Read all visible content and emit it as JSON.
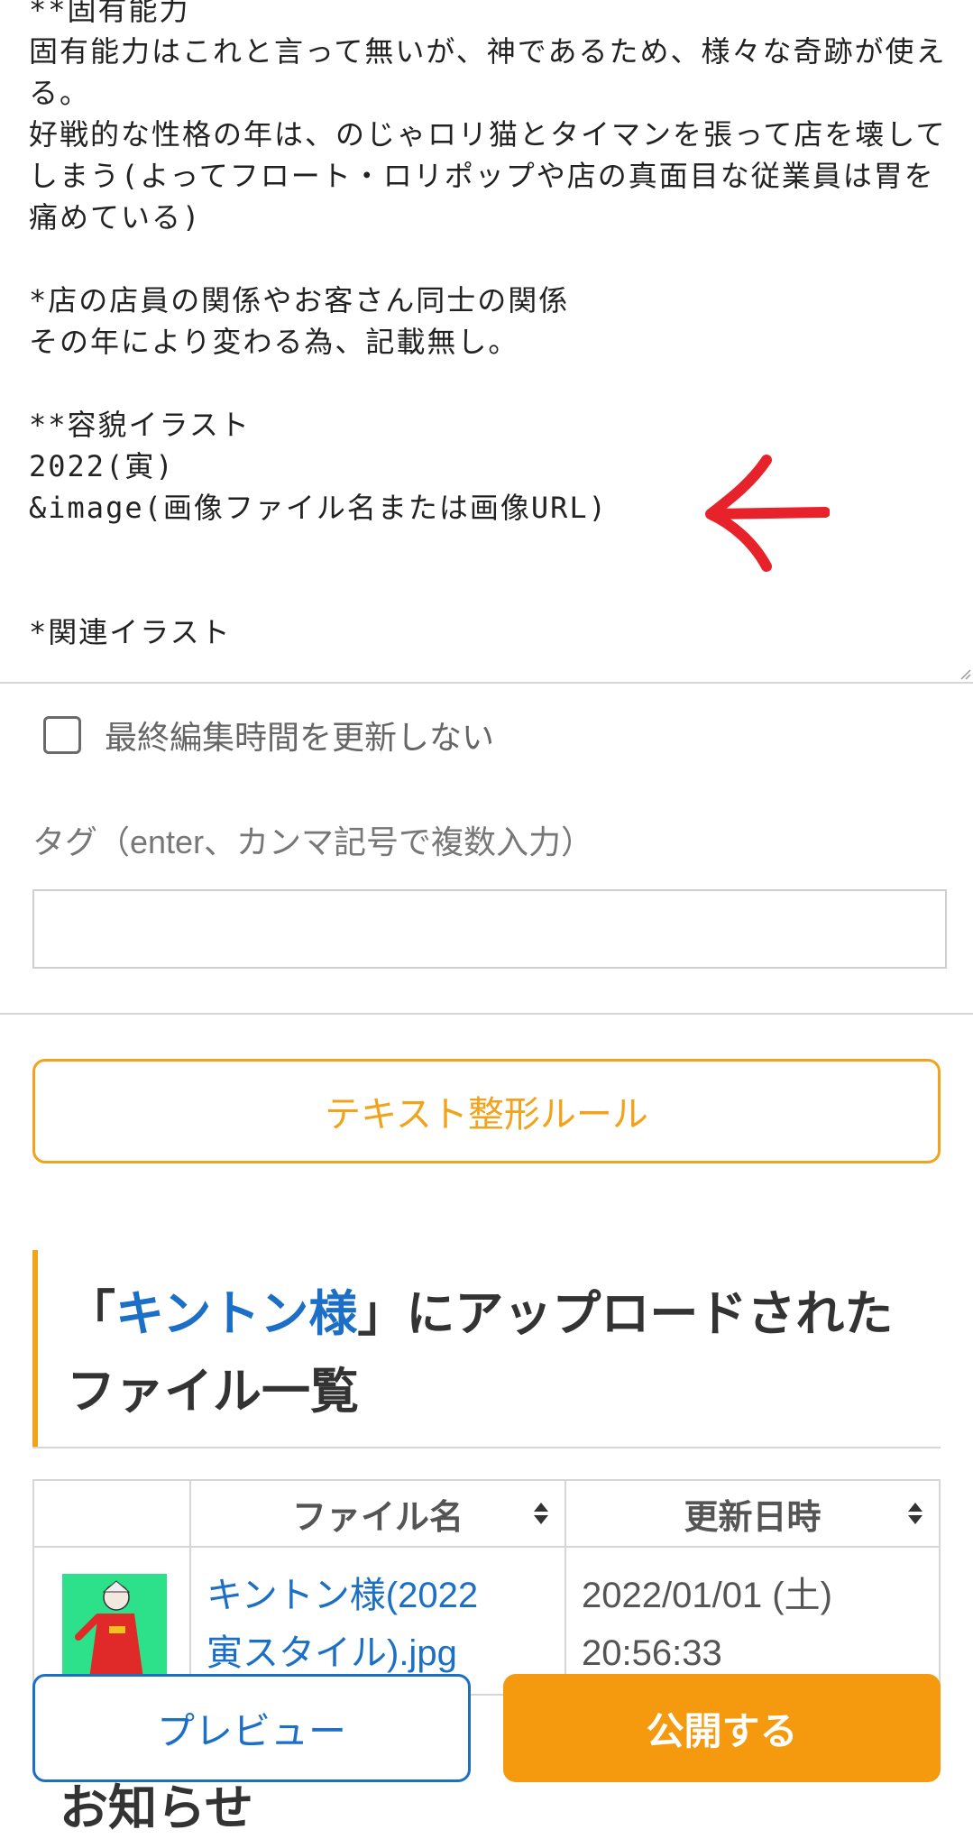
{
  "editor": {
    "lines": [
      "**固有能力",
      "固有能力はこれと言って無いが、神であるため、様々な奇跡が使える。",
      "好戦的な性格の年は、のじゃロリ猫とタイマンを張って店を壊してしまう(よってフロート・ロリポップや店の真面目な従業員は胃を痛めている)",
      "",
      "*店の店員の関係やお客さん同士の関係",
      "その年により変わる為、記載無し。",
      "",
      "**容貌イラスト",
      "2022(寅)",
      "&image(画像ファイル名または画像URL)",
      "",
      "",
      "*関連イラスト"
    ]
  },
  "options": {
    "no_update_label": "最終編集時間を更新しない",
    "no_update_checked": false
  },
  "tags": {
    "label": "タグ（enter、カンマ記号で複数入力）",
    "value": ""
  },
  "rules_button": "テキスト整形ルール",
  "uploads": {
    "heading_open": "「",
    "heading_name": "キントン様",
    "heading_rest": "」にアップロードされたファイル一覧",
    "columns": [
      "",
      "ファイル名",
      "更新日時"
    ],
    "rows": [
      {
        "file_name": "キントン様(2022　寅スタイル).jpg",
        "updated": "2022/01/01 (土) 20:56:33"
      }
    ]
  },
  "bottom_heading": "お知らせ",
  "actions": {
    "preview": "プレビュー",
    "publish": "公開する"
  },
  "colors": {
    "accent_orange": "#f0a31b",
    "link_blue": "#1b6fc7",
    "annotation_red": "#e8222a"
  }
}
